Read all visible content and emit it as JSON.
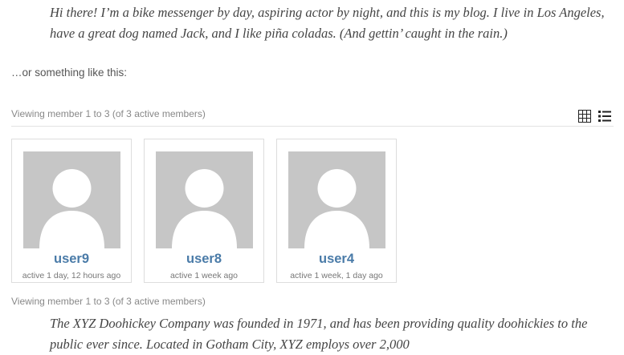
{
  "intro": {
    "quote": "Hi there! I’m a bike messenger by day, aspiring actor by night, and this is my blog. I live in Los Angeles, have a great dog named Jack, and I like piña coladas. (And gettin’ caught in the rain.)",
    "lead_in": "…or something like this:"
  },
  "directory": {
    "pagination_top": "Viewing member 1 to 3 (of 3 active members)",
    "pagination_bottom": "Viewing member 1 to 3 (of 3 active members)",
    "view_grid_icon": "grid-view-icon",
    "view_list_icon": "list-view-icon",
    "members": [
      {
        "name": "user9",
        "activity": "active 1 day, 12 hours ago"
      },
      {
        "name": "user8",
        "activity": "active 1 week ago"
      },
      {
        "name": "user4",
        "activity": "active 1 week, 1 day ago"
      }
    ]
  },
  "outro": {
    "quote": "The XYZ Doohickey Company was founded in 1971, and has been providing quality doohickies to the public ever since. Located in Gotham City, XYZ employs over 2,000"
  },
  "colors": {
    "link": "#4a7ba8",
    "avatar_bg": "#c6c6c6",
    "avatar_fg": "#ffffff"
  }
}
